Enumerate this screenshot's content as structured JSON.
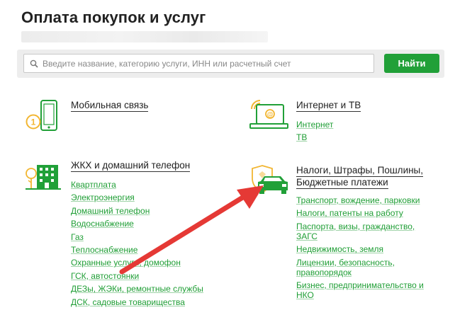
{
  "page": {
    "title": "Оплата покупок и услуг"
  },
  "search": {
    "placeholder": "Введите название, категорию услуги, ИНН или расчетный счет",
    "button_label": "Найти"
  },
  "categories": [
    {
      "title": "Мобильная связь",
      "icon": "mobile-phone-icon",
      "links": []
    },
    {
      "title": "Интернет и ТВ",
      "icon": "laptop-internet-icon",
      "links": [
        "Интернет",
        "ТВ"
      ]
    },
    {
      "title": "ЖКХ и домашний телефон",
      "icon": "house-building-icon",
      "links": [
        "Квартплата",
        "Электроэнергия",
        "Домашний телефон",
        "Водоснабжение",
        "Газ",
        "Теплоснабжение",
        "Охранные услуги, домофон",
        "ГСК, автостоянки",
        "ДЕЗы, ЖЭКи, ремонтные службы",
        "ДСК, садовые товарищества"
      ]
    },
    {
      "title_line1": "Налоги, Штрафы, Пошлины,",
      "title_line2": "Бюджетные платежи",
      "icon": "car-emblem-icon",
      "links": [
        "Транспорт, вождение, парковки",
        "Налоги, патенты на работу",
        "Паспорта, визы, гражданство,",
        "ЗАГС",
        "Недвижимость, земля",
        "Лицензии, безопасность,",
        "правопорядок",
        "Бизнес, предпринимательство и",
        "НКО"
      ]
    }
  ],
  "colors": {
    "accent": "#21a038",
    "link": "#1f9e35",
    "icon_yellow": "#f2b632",
    "arrow": "#e53935"
  }
}
